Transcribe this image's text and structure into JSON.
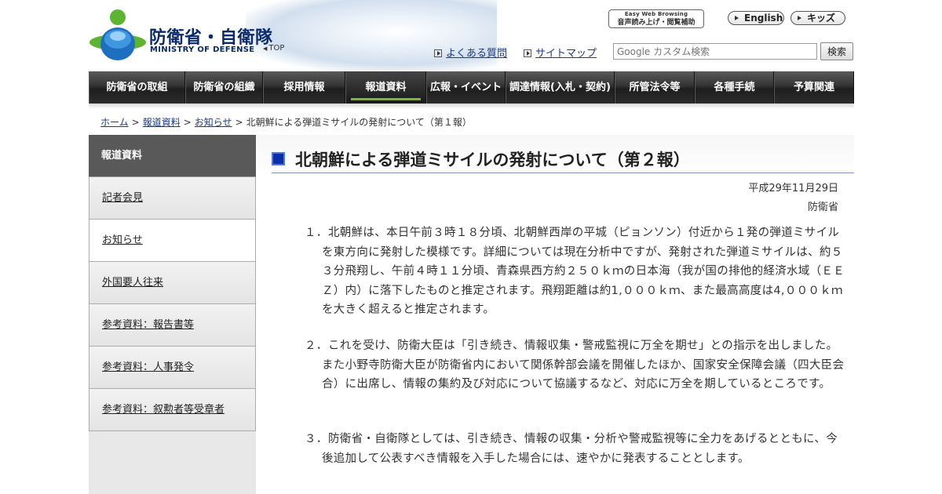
{
  "header": {
    "logo_text_jp": "防衛省・自衛隊",
    "logo_text_en": "MINISTRY OF DEFENSE",
    "top_link": "TOP",
    "easy_web_line1": "Easy Web Browsing",
    "easy_web_line2": "音声読み上げ・閲覧補助",
    "english_label": "English",
    "kids_label": "キッズ",
    "faq_label": "よくある質問",
    "sitemap_label": "サイトマップ",
    "search_placeholder": "Google カスタム検索",
    "search_button": "検索"
  },
  "nav": {
    "items": [
      {
        "label": "防衛省の取組"
      },
      {
        "label": "防衛省の組織"
      },
      {
        "label": "採用情報"
      },
      {
        "label": "報道資料"
      },
      {
        "label": "広報・イベント"
      },
      {
        "label": "調達情報(入札・契約)"
      },
      {
        "label": "所管法令等"
      },
      {
        "label": "各種手続"
      },
      {
        "label": "予算関連"
      }
    ],
    "active_index": 3
  },
  "breadcrumb": {
    "items": [
      "ホーム",
      "報道資料",
      "お知らせ"
    ],
    "current": "北朝鮮による弾道ミサイルの発射について（第１報）",
    "separator": ">"
  },
  "sidebar": {
    "heading": "報道資料",
    "items": [
      {
        "label": "記者会見"
      },
      {
        "label": "お知らせ"
      },
      {
        "label": "外国要人往来"
      },
      {
        "label": "参考資料：報告書等"
      },
      {
        "label": "参考資料：人事発令"
      },
      {
        "label": "参考資料：叙勲者等受章者"
      }
    ],
    "current_index": 1
  },
  "article": {
    "title": "北朝鮮による弾道ミサイルの発射について（第２報）",
    "date": "平成29年11月29日",
    "org": "防衛省",
    "paragraphs": [
      {
        "num": "１．",
        "text": "北朝鮮は、本日午前３時１８分頃、北朝鮮西岸の平城（ピョンソン）付近から１発の弾道ミサイルを東方向に発射した模様です。詳細については現在分析中ですが、発射された弾道ミサイルは、約５３分飛翔し、午前４時１１分頃、青森県西方約２５０ｋｍの日本海（我が国の排他的経済水域（ＥＥＺ）内）に落下したものと推定されます。飛翔距離は約1,０００ｋｍ、また最高高度は4,０００ｋｍを大きく超えると推定されます。"
      },
      {
        "num": "２．",
        "text": "これを受け、防衛大臣は「引き続き、情報収集・警戒監視に万全を期せ」との指示を出しました。また小野寺防衛大臣が防衛省内において関係幹部会議を開催したほか、国家安全保障会議（四大臣会合）に出席し、情報の集約及び対応について協議するなど、対応に万全を期しているところです。"
      },
      {
        "num": "３．",
        "text": "防衛省・自衛隊としては、引き続き、情報の収集・分析や警戒監視等に全力をあげるとともに、今後追加して公表すべき情報を入手した場合には、速やかに発表することとします。"
      }
    ]
  },
  "colors": {
    "nav_active_underline": "#78b832",
    "title_square": "#0a2fa6",
    "link": "#1a3a8a",
    "sidebar_head": "#595959",
    "logo_blue": "#0a2a6e",
    "logo_green": "#5cb531"
  }
}
